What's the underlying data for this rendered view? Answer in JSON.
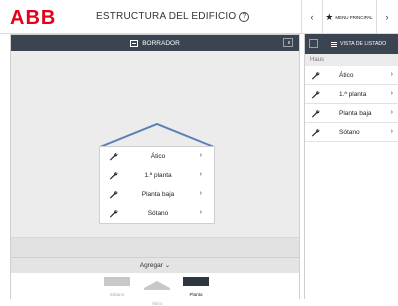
{
  "header": {
    "brand": "ABB",
    "title": "ESTRUCTURA DEL EDIFICIO",
    "help_icon": "?",
    "nav_prev": "‹",
    "nav_next": "›",
    "main_menu_icon": "star-icon",
    "main_menu_label": "MENU PRINCIPAL"
  },
  "left_panel": {
    "toolbar_label": "BORRADOR",
    "floors": [
      {
        "name": "Ático",
        "chevron": "›"
      },
      {
        "name": "1.ª planta",
        "chevron": "›"
      },
      {
        "name": "Planta baja",
        "chevron": "›"
      },
      {
        "name": "Sótano",
        "chevron": "›"
      }
    ],
    "add_label": "Agregar ⌄",
    "tray": [
      {
        "label": "Sótano",
        "active": false
      },
      {
        "label": "Ático",
        "active": false
      },
      {
        "label": "Planta",
        "active": true
      }
    ]
  },
  "right_panel": {
    "toolbar_label": "VISTA DE LISTADO",
    "breadcrumb": "Haus",
    "items": [
      {
        "name": "Ático",
        "chevron": "›"
      },
      {
        "name": "1.ª planta",
        "chevron": "›"
      },
      {
        "name": "Planta baja",
        "chevron": "›"
      },
      {
        "name": "Sótano",
        "chevron": "›"
      }
    ]
  },
  "colors": {
    "brand_red": "#e2001a",
    "toolbar_dark": "#3b4551",
    "roof_blue": "#5b7fb8",
    "panel_grey": "#ececec"
  }
}
